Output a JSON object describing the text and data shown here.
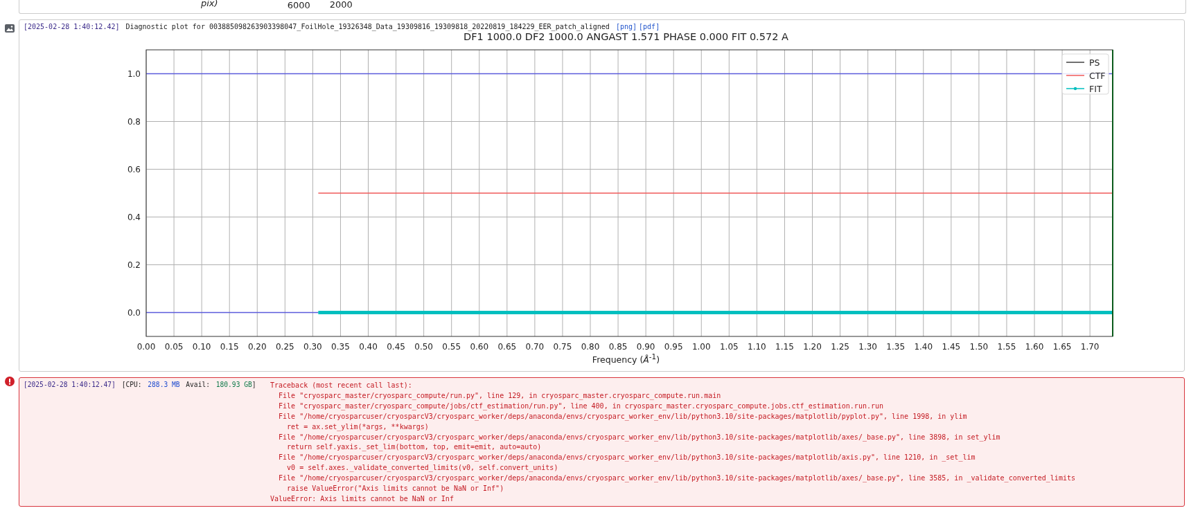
{
  "previous_card": {
    "texts": [
      "pix)",
      "6000",
      "2000"
    ]
  },
  "plot_entry": {
    "timestamp": "[2025-02-28 1:40:12.42]",
    "message": "Diagnostic plot for 003885098263903398047_FoilHole_19326348_Data_19309816_19309818_20220819_184229_EER_patch_aligned",
    "links": [
      "[png]",
      "[pdf]"
    ],
    "chart_data": {
      "type": "line",
      "title": "DF1 1000.0 DF2 1000.0 ANGAST 1.571 PHASE 0.000 FIT 0.572 A",
      "xlabel": "Frequency (*Å*$^{-1}$)",
      "x": [
        0,
        0.31,
        1.741
      ],
      "series": [
        {
          "color": "#5b5bdc",
          "values": [
            1,
            1,
            1
          ]
        },
        {
          "color": "#5b5bdc",
          "values": [
            0,
            0,
            null
          ]
        },
        {
          "name": "PS",
          "color": "#404040",
          "values": [
            null,
            null,
            null
          ]
        },
        {
          "name": "CTF",
          "color": "#f05a5a",
          "values": [
            null,
            0.5,
            0.5
          ]
        },
        {
          "name": "FIT",
          "color": "#00bfbf",
          "values": [
            null,
            0,
            0
          ]
        }
      ],
      "xlim": [
        0,
        1.741
      ],
      "ylim": [
        -0.1,
        1.1
      ],
      "grid": true,
      "legend": true,
      "xticks": [
        {
          "value": 0,
          "label": "0.00"
        },
        {
          "value": 0.05,
          "label": "0.05"
        },
        {
          "value": 0.1,
          "label": "0.10"
        },
        {
          "value": 0.15,
          "label": "0.15"
        },
        {
          "value": 0.2,
          "label": "0.20"
        },
        {
          "value": 0.25,
          "label": "0.25"
        },
        {
          "value": 0.3,
          "label": "0.30"
        },
        {
          "value": 0.35,
          "label": "0.35"
        },
        {
          "value": 0.4,
          "label": "0.40"
        },
        {
          "value": 0.45,
          "label": "0.45"
        },
        {
          "value": 0.5,
          "label": "0.50"
        },
        {
          "value": 0.55,
          "label": "0.55"
        },
        {
          "value": 0.6,
          "label": "0.60"
        },
        {
          "value": 0.65,
          "label": "0.65"
        },
        {
          "value": 0.7,
          "label": "0.70"
        },
        {
          "value": 0.75,
          "label": "0.75"
        },
        {
          "value": 0.8,
          "label": "0.80"
        },
        {
          "value": 0.85,
          "label": "0.85"
        },
        {
          "value": 0.9,
          "label": "0.90"
        },
        {
          "value": 0.95,
          "label": "0.95"
        },
        {
          "value": 1.0,
          "label": "1.00"
        },
        {
          "value": 1.05,
          "label": "1.05"
        },
        {
          "value": 1.1,
          "label": "1.10"
        },
        {
          "value": 1.15,
          "label": "1.15"
        },
        {
          "value": 1.2,
          "label": "1.20"
        },
        {
          "value": 1.25,
          "label": "1.25"
        },
        {
          "value": 1.3,
          "label": "1.30"
        },
        {
          "value": 1.35,
          "label": "1.35"
        },
        {
          "value": 1.4,
          "label": "1.40"
        },
        {
          "value": 1.45,
          "label": "1.45"
        },
        {
          "value": 1.5,
          "label": "1.50"
        },
        {
          "value": 1.55,
          "label": "1.55"
        },
        {
          "value": 1.6,
          "label": "1.60"
        },
        {
          "value": 1.65,
          "label": "1.65"
        },
        {
          "value": 1.7,
          "label": "1.70"
        }
      ],
      "yticks": [
        {
          "value": 0,
          "label": "0.0"
        },
        {
          "value": 0.2,
          "label": "0.2"
        },
        {
          "value": 0.4,
          "label": "0.4"
        },
        {
          "value": 0.6,
          "label": "0.6"
        },
        {
          "value": 0.8,
          "label": "0.8"
        },
        {
          "value": 1.0,
          "label": "1.0"
        }
      ]
    }
  },
  "error_entry": {
    "timestamp": "[2025-02-28 1:40:12.47]",
    "cpu_label": "[CPU:",
    "cpu_value": "288.3 MB",
    "avail_label": "Avail:",
    "avail_value": "180.93 GB",
    "meta_close": "]",
    "traceback": [
      "Traceback (most recent call last):",
      "  File \"cryosparc_master/cryosparc_compute/run.py\", line 129, in cryosparc_master.cryosparc_compute.run.main",
      "  File \"cryosparc_master/cryosparc_compute/jobs/ctf_estimation/run.py\", line 400, in cryosparc_master.cryosparc_compute.jobs.ctf_estimation.run.run",
      "  File \"/home/cryosparcuser/cryosparcV3/cryosparc_worker/deps/anaconda/envs/cryosparc_worker_env/lib/python3.10/site-packages/matplotlib/pyplot.py\", line 1998, in ylim",
      "    ret = ax.set_ylim(*args, **kwargs)",
      "  File \"/home/cryosparcuser/cryosparcV3/cryosparc_worker/deps/anaconda/envs/cryosparc_worker_env/lib/python3.10/site-packages/matplotlib/axes/_base.py\", line 3898, in set_ylim",
      "    return self.yaxis._set_lim(bottom, top, emit=emit, auto=auto)",
      "  File \"/home/cryosparcuser/cryosparcV3/cryosparc_worker/deps/anaconda/envs/cryosparc_worker_env/lib/python3.10/site-packages/matplotlib/axis.py\", line 1210, in _set_lim",
      "    v0 = self.axes._validate_converted_limits(v0, self.convert_units)",
      "  File \"/home/cryosparcuser/cryosparcV3/cryosparc_worker/deps/anaconda/envs/cryosparc_worker_env/lib/python3.10/site-packages/matplotlib/axes/_base.py\", line 3585, in _validate_converted_limits",
      "    raise ValueError(\"Axis limits cannot be NaN or Inf\")",
      "ValueError: Axis limits cannot be NaN or Inf"
    ]
  }
}
